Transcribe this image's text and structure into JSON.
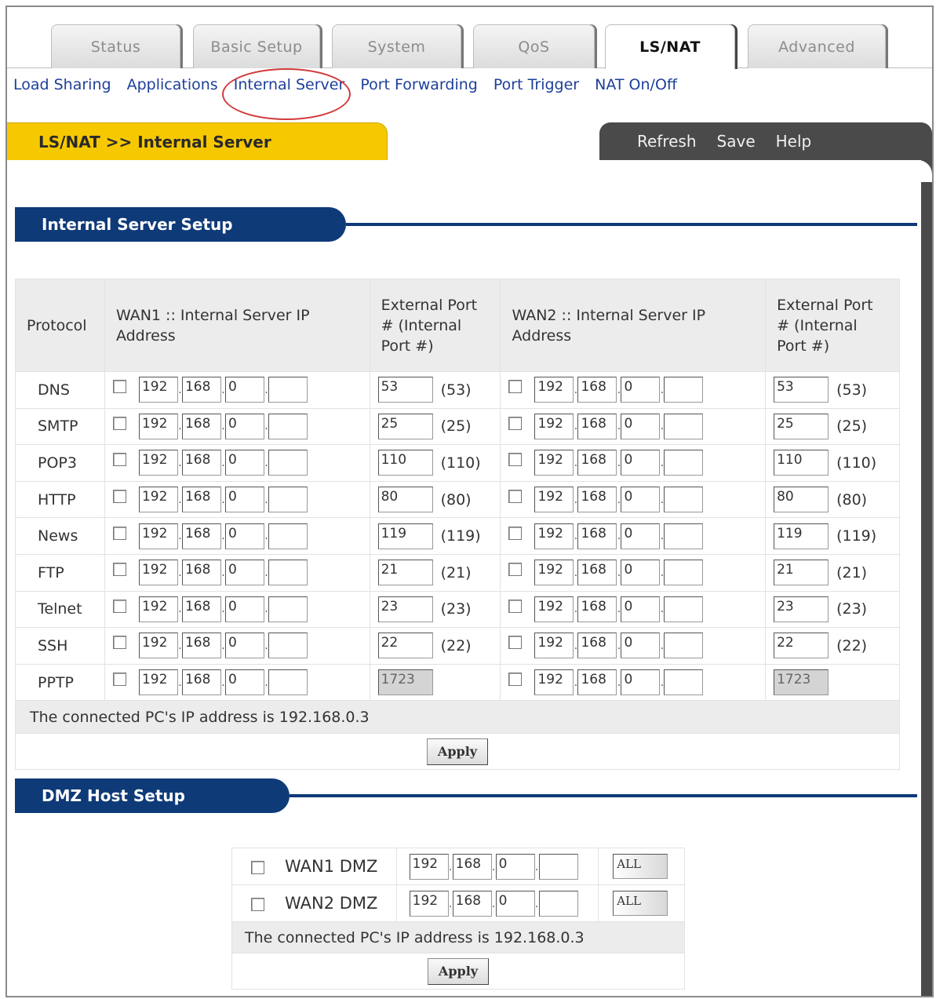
{
  "tabs": [
    {
      "label": "Status"
    },
    {
      "label": "Basic Setup"
    },
    {
      "label": "System"
    },
    {
      "label": "QoS"
    },
    {
      "label": "LS/NAT"
    },
    {
      "label": "Advanced"
    }
  ],
  "subnav": [
    {
      "label": "Load Sharing"
    },
    {
      "label": "Applications"
    },
    {
      "label": "Internal Server"
    },
    {
      "label": "Port Forwarding"
    },
    {
      "label": "Port Trigger"
    },
    {
      "label": "NAT On/Off"
    }
  ],
  "titlebar": {
    "title": "LS/NAT >> Internal Server",
    "refresh": "Refresh",
    "save": "Save",
    "help": "Help"
  },
  "internal_server": {
    "heading": "Internal Server Setup",
    "headers": {
      "protocol": "Protocol",
      "wan1": "WAN1 :: Internal Server IP Address",
      "ext_port_1": "External Port # (Internal Port #)",
      "wan2": "WAN2 :: Internal Server IP Address",
      "ext_port_2": "External Port # (Internal Port #)"
    },
    "rows": [
      {
        "protocol": "DNS",
        "wan1": [
          "192",
          "168",
          "0",
          ""
        ],
        "port1": "53",
        "internal1": "(53)",
        "wan2": [
          "192",
          "168",
          "0",
          ""
        ],
        "port2": "53",
        "internal2": "(53)"
      },
      {
        "protocol": "SMTP",
        "wan1": [
          "192",
          "168",
          "0",
          ""
        ],
        "port1": "25",
        "internal1": "(25)",
        "wan2": [
          "192",
          "168",
          "0",
          ""
        ],
        "port2": "25",
        "internal2": "(25)"
      },
      {
        "protocol": "POP3",
        "wan1": [
          "192",
          "168",
          "0",
          ""
        ],
        "port1": "110",
        "internal1": "(110)",
        "wan2": [
          "192",
          "168",
          "0",
          ""
        ],
        "port2": "110",
        "internal2": "(110)"
      },
      {
        "protocol": "HTTP",
        "wan1": [
          "192",
          "168",
          "0",
          ""
        ],
        "port1": "80",
        "internal1": "(80)",
        "wan2": [
          "192",
          "168",
          "0",
          ""
        ],
        "port2": "80",
        "internal2": "(80)"
      },
      {
        "protocol": "News",
        "wan1": [
          "192",
          "168",
          "0",
          ""
        ],
        "port1": "119",
        "internal1": "(119)",
        "wan2": [
          "192",
          "168",
          "0",
          ""
        ],
        "port2": "119",
        "internal2": "(119)"
      },
      {
        "protocol": "FTP",
        "wan1": [
          "192",
          "168",
          "0",
          ""
        ],
        "port1": "21",
        "internal1": "(21)",
        "wan2": [
          "192",
          "168",
          "0",
          ""
        ],
        "port2": "21",
        "internal2": "(21)"
      },
      {
        "protocol": "Telnet",
        "wan1": [
          "192",
          "168",
          "0",
          ""
        ],
        "port1": "23",
        "internal1": "(23)",
        "wan2": [
          "192",
          "168",
          "0",
          ""
        ],
        "port2": "23",
        "internal2": "(23)"
      },
      {
        "protocol": "SSH",
        "wan1": [
          "192",
          "168",
          "0",
          ""
        ],
        "port1": "22",
        "internal1": "(22)",
        "wan2": [
          "192",
          "168",
          "0",
          ""
        ],
        "port2": "22",
        "internal2": "(22)"
      },
      {
        "protocol": "PPTP",
        "wan1": [
          "192",
          "168",
          "0",
          ""
        ],
        "port1": "1723",
        "internal1": "",
        "wan2": [
          "192",
          "168",
          "0",
          ""
        ],
        "port2": "1723",
        "internal2": ""
      }
    ],
    "status": "The connected PC's IP address is 192.168.0.3",
    "apply": "Apply"
  },
  "dmz": {
    "heading": "DMZ Host Setup",
    "rows": [
      {
        "label": "WAN1 DMZ",
        "ip": [
          "192",
          "168",
          "0",
          ""
        ],
        "select": "ALL"
      },
      {
        "label": "WAN2 DMZ",
        "ip": [
          "192",
          "168",
          "0",
          ""
        ],
        "select": "ALL"
      }
    ],
    "status": "The connected PC's IP address is 192.168.0.3",
    "apply": "Apply"
  },
  "colors": {
    "accent_yellow": "#f6c800",
    "header_navy": "#0f3a78",
    "link_blue": "#1d3f9a",
    "highlight_red": "#d23a3a"
  }
}
